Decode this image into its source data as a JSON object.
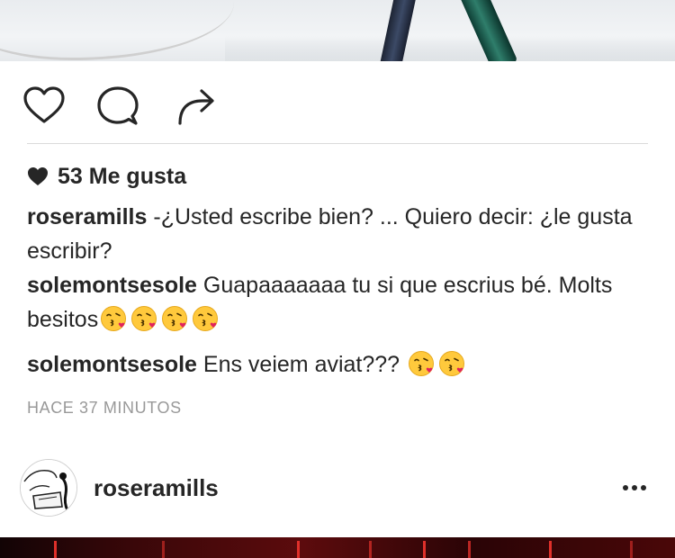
{
  "post": {
    "likes_text": "53 Me gusta",
    "caption": {
      "user": "roseramills",
      "text": "-¿Usted escribe bien? ... Quiero decir: ¿le gusta escribir?"
    },
    "comments": [
      {
        "user": "solemontsesole",
        "text": "Guapaaaaaaa tu si que escrius bé. Molts besitos",
        "emoji_count": 4,
        "emoji": "face-throwing-kiss-icon"
      },
      {
        "user": "solemontsesole",
        "text": "Ens veiem aviat???",
        "emoji_count": 2,
        "emoji": "face-throwing-kiss-icon"
      }
    ],
    "timestamp": "HACE 37 MINUTOS"
  },
  "next_post": {
    "username": "roseramills"
  },
  "icons": {
    "like": "heart-outline-icon",
    "comment": "speech-bubble-icon",
    "share": "share-arrow-icon",
    "more": "more-options-icon"
  },
  "colors": {
    "text": "#262626",
    "muted": "#999999",
    "divider": "#dbdbdb",
    "emoji_face": "#ffc93c",
    "emoji_heart": "#e0245e"
  }
}
